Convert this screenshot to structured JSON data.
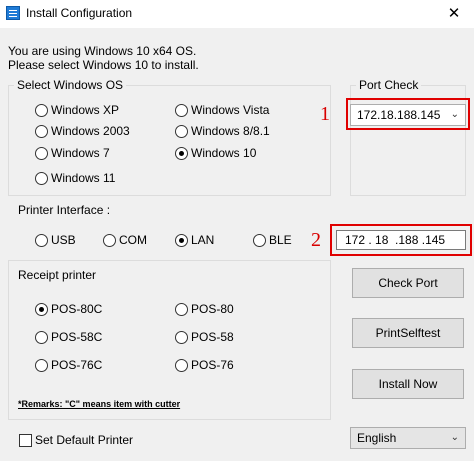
{
  "window": {
    "title": "Install Configuration",
    "close_glyph": "✕"
  },
  "intro": {
    "line1": "You are using Windows 10 x64 OS.",
    "line2": "Please select Windows 10 to install."
  },
  "os_group": {
    "label": "Select Windows OS",
    "options": [
      {
        "label": "Windows XP",
        "selected": false
      },
      {
        "label": "Windows Vista",
        "selected": false
      },
      {
        "label": "Windows 2003",
        "selected": false
      },
      {
        "label": "Windows 8/8.1",
        "selected": false
      },
      {
        "label": "Windows 7",
        "selected": false
      },
      {
        "label": "Windows 10",
        "selected": true
      },
      {
        "label": "Windows 11",
        "selected": false
      }
    ]
  },
  "port_check": {
    "label": "Port Check",
    "selected_value": "172.18.188.145",
    "marker": "1"
  },
  "printer_interface": {
    "label": "Printer Interface :",
    "options": [
      {
        "label": "USB",
        "selected": false
      },
      {
        "label": "COM",
        "selected": false
      },
      {
        "label": "LAN",
        "selected": true
      },
      {
        "label": "BLE",
        "selected": false
      }
    ],
    "ip_value": "172 . 18  .188 .145",
    "marker": "2"
  },
  "receipt_group": {
    "label": "Receipt printer",
    "options": [
      {
        "label": "POS-80C",
        "selected": true
      },
      {
        "label": "POS-80",
        "selected": false
      },
      {
        "label": "POS-58C",
        "selected": false
      },
      {
        "label": "POS-58",
        "selected": false
      },
      {
        "label": "POS-76C",
        "selected": false
      },
      {
        "label": "POS-76",
        "selected": false
      }
    ],
    "remarks": "*Remarks: \"C\" means item with cutter"
  },
  "buttons": {
    "check_port": "Check Port",
    "print_selftest": "PrintSelftest",
    "install_now": "Install Now"
  },
  "default_printer": {
    "label": "Set Default Printer",
    "checked": false
  },
  "language": {
    "selected_value": "English"
  },
  "colors": {
    "highlight_red": "#e00000",
    "window_bg": "#f0f0f0"
  }
}
